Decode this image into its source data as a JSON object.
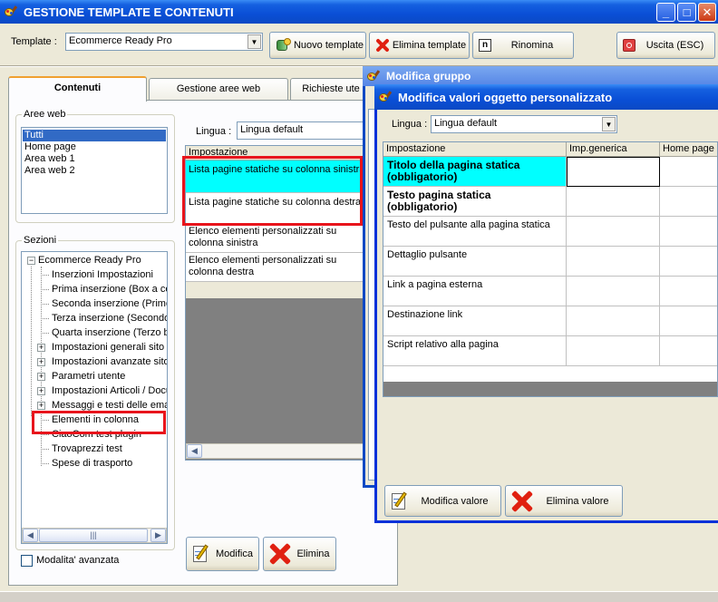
{
  "main_window": {
    "title": "GESTIONE TEMPLATE E CONTENUTI",
    "template_label": "Template :",
    "template_value": "Ecommerce Ready Pro",
    "btn_nuovo": "Nuovo template",
    "btn_elimina": "Elimina template",
    "btn_rinomina": "Rinomina",
    "btn_uscita": "Uscita (ESC)",
    "tabs": [
      "Contenuti",
      "Gestione aree web",
      "Richieste ute"
    ]
  },
  "aree_web": {
    "legend": "Aree web",
    "items": [
      "Tutti",
      "Home page",
      "Area web 1",
      "Area web 2"
    ]
  },
  "sezioni": {
    "legend": "Sezioni",
    "root": "Ecommerce Ready Pro",
    "items": [
      "Inserzioni Impostazioni",
      "Prima inserzione (Box a cer",
      "Seconda inserzione (Primo",
      "Terza inserzione (Secondo",
      "Quarta inserzione (Terzo b",
      "Impostazioni generali sito",
      "Impostazioni avanzate sito",
      "Parametri utente",
      "Impostazioni Articoli / Docu",
      "Messaggi e testi delle emai",
      "Elementi in colonna",
      "CiaoCom test plugin",
      "Trovaprezzi test",
      "Spese di trasporto"
    ]
  },
  "modalita": "Modalita' avanzata",
  "middle": {
    "lingua_label": "Lingua :",
    "lingua_value": "Lingua default",
    "header": "Impostazione",
    "rows": [
      "Lista pagine statiche su colonna sinistra",
      "Lista pagine statiche su colonna destra",
      "Elenco elementi personalizzati su colonna sinistra",
      "Elenco elementi personalizzati su colonna destra"
    ],
    "btn_modifica": "Modifica",
    "btn_elimina": "Elimina"
  },
  "gruppo_window": {
    "title": "Modifica gruppo"
  },
  "dialog": {
    "title": "Modifica valori oggetto personalizzato",
    "lingua_label": "Lingua :",
    "lingua_value": "Lingua default",
    "columns": [
      "Impostazione",
      "Imp.generica",
      "Home page"
    ],
    "rows": [
      "Titolo della pagina statica (obbligatorio)",
      "Testo pagina statica (obbligatorio)",
      "Testo del pulsante alla pagina statica",
      "Dettaglio pulsante",
      "Link a pagina esterna",
      "Destinazione link",
      "Script relativo alla pagina"
    ],
    "btn_modifica": "Modifica valore",
    "btn_elimina": "Elimina valore"
  },
  "colors": {
    "title_blue": "#0a4fd6",
    "selected_cyan": "#00ffff",
    "list_selected": "#316ac5",
    "highlight_red": "#e8141c"
  }
}
